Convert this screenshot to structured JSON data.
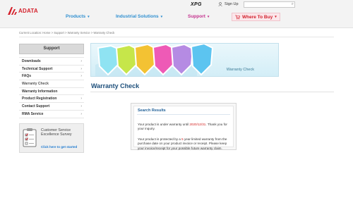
{
  "header": {
    "logo": "ADATA",
    "brand_xpg": "XPG",
    "sign_up": "Sign Up",
    "search_placeholder": ""
  },
  "nav": {
    "items": [
      {
        "label": "Products"
      },
      {
        "label": "Industrial Solutions"
      },
      {
        "label": "Support"
      },
      {
        "label": "Where To Buy"
      }
    ]
  },
  "breadcrumb": "Current Location: Home > Support > Warranty Service > Warranty Check",
  "sidebar": {
    "title": "Support",
    "items": [
      {
        "label": "Downloads",
        "active": false
      },
      {
        "label": "Technical Support",
        "active": false
      },
      {
        "label": "FAQs",
        "active": false
      },
      {
        "label": "Warranty Check",
        "active": true
      },
      {
        "label": "Warranty Information",
        "active": false
      },
      {
        "label": "Product Registration",
        "active": false
      },
      {
        "label": "Contact Support",
        "active": false
      },
      {
        "label": "RMA Service",
        "active": false
      }
    ],
    "survey": {
      "title": "Customer Service Excellence Survey",
      "link": "Click here to get started"
    }
  },
  "banner": {
    "title": "Warranty Check"
  },
  "main": {
    "page_title": "Warranty Check",
    "result": {
      "heading": "Search Results",
      "p1_pre": "Your product is under warranty until ",
      "date": "2020/12/31",
      "p1_post": ". Thank you for your inquiry.",
      "p2_pre": "Your product is protected by a ",
      "years": "5",
      "p2_post": " year limited warranty from the purchase date on your product invoice or receipt. Please keep your invoice/receipt for your possible future warranty claim."
    }
  },
  "colors": {
    "brand_red": "#d4202b",
    "nav_blue": "#2f8fd0",
    "support_magenta": "#c4318e",
    "title_blue": "#1d4f7b",
    "highlight_red": "#d3211f"
  }
}
